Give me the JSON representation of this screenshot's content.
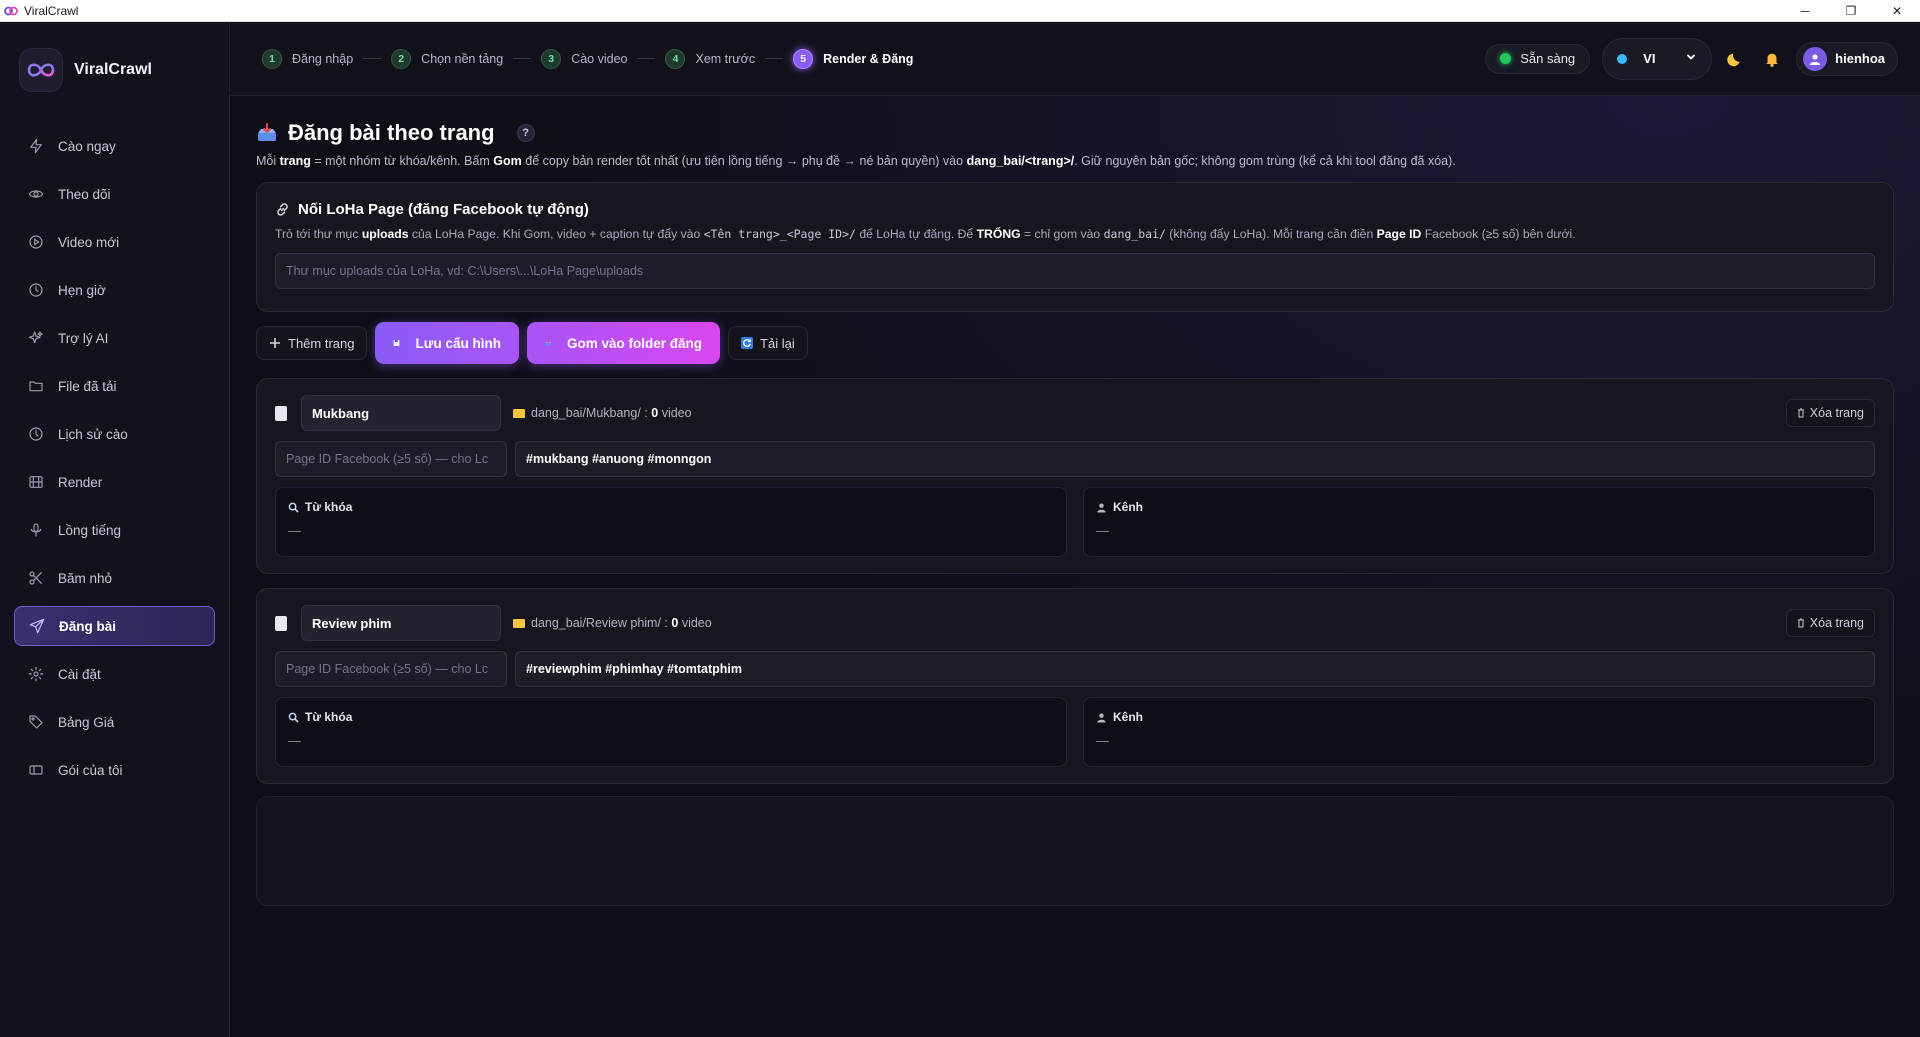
{
  "window": {
    "title": "ViralCrawl",
    "minimize": "─",
    "restore": "❐",
    "close": "✕"
  },
  "brand": {
    "name": "ViralCrawl"
  },
  "sidebar": {
    "items": [
      {
        "label": "Cào ngay",
        "icon": "bolt-icon"
      },
      {
        "label": "Theo dõi",
        "icon": "eye-icon"
      },
      {
        "label": "Video mới",
        "icon": "play-circle-icon"
      },
      {
        "label": "Hẹn giờ",
        "icon": "clock-icon"
      },
      {
        "label": "Trợ lý AI",
        "icon": "sparkle-icon"
      },
      {
        "label": "File đã tải",
        "icon": "folder-icon"
      },
      {
        "label": "Lịch sử cào",
        "icon": "history-icon"
      },
      {
        "label": "Render",
        "icon": "film-icon"
      },
      {
        "label": "Lồng tiếng",
        "icon": "mic-icon"
      },
      {
        "label": "Băm nhỏ",
        "icon": "scissors-icon"
      },
      {
        "label": "Đăng bài",
        "icon": "send-icon",
        "active": true
      },
      {
        "label": "Cài đặt",
        "icon": "gear-icon"
      },
      {
        "label": "Bảng Giá",
        "icon": "tag-icon"
      },
      {
        "label": "Gói của tôi",
        "icon": "ticket-icon"
      }
    ]
  },
  "steps": [
    {
      "num": "1",
      "label": "Đăng nhập"
    },
    {
      "num": "2",
      "label": "Chọn nền tảng"
    },
    {
      "num": "3",
      "label": "Cào video"
    },
    {
      "num": "4",
      "label": "Xem trước"
    },
    {
      "num": "5",
      "label": "Render & Đăng"
    }
  ],
  "topbar": {
    "status": "Sẵn sàng",
    "lang": "VI",
    "user": "hienhoa"
  },
  "colors": {
    "accent": "#8b5cf6",
    "accent_pink": "#d946ef",
    "status_ok": "#22c55e",
    "background": "#0f0e17"
  },
  "main": {
    "title": "Đăng bài theo trang",
    "help": "?",
    "desc": {
      "p1": "Mỗi ",
      "b1": "trang",
      "p2": " = một nhóm từ khóa/kênh. Bấm ",
      "b2": "Gom",
      "p3": " để copy bản render tốt nhất (ưu tiên lồng tiếng → phụ đề → né bản quyền) vào ",
      "b3": "dang_bai/<trang>/",
      "p4": ". Giữ nguyên bản gốc; không gom trùng (kể cả khi tool đăng đã xóa)."
    },
    "loha": {
      "title": "Nối LoHa Page (đăng Facebook tự động)",
      "d1": "Trỏ tới thư mục ",
      "d1b": "uploads",
      "d2": " của LoHa Page. Khi Gom, video + caption tự đẩy vào ",
      "d2m": "<Tên trang>_<Page ID>/",
      "d3": " để LoHa tự đăng. Để ",
      "d3b": "TRỐNG",
      "d4": " = chỉ gom vào ",
      "d4m": "dang_bai/",
      "d5": " (không đẩy LoHa). Mỗi trang cần điền ",
      "d5b": "Page ID",
      "d6": " Facebook (≥5 số) bên dưới.",
      "placeholder": "Thư mục uploads của LoHa, vd: C:\\Users\\...\\LoHa Page\\uploads"
    },
    "toolbar": {
      "add": "Thêm trang",
      "save": "Lưu cấu hình",
      "gather": "Gom vào folder đăng",
      "reload": "Tải lại"
    },
    "pages": [
      {
        "name": "Mukbang",
        "folder": "dang_bai/Mukbang/ :",
        "count": "0",
        "count_unit": "video",
        "delete": "Xóa trang",
        "pid_placeholder": "Page ID Facebook (≥5 số) — cho Lc",
        "tags": "#mukbang #anuong #monngon",
        "keywords_label": "Từ khóa",
        "keywords_value": "—",
        "channels_label": "Kênh",
        "channels_value": "—"
      },
      {
        "name": "Review phim",
        "folder": "dang_bai/Review phim/ :",
        "count": "0",
        "count_unit": "video",
        "delete": "Xóa trang",
        "pid_placeholder": "Page ID Facebook (≥5 số) — cho Lc",
        "tags": "#reviewphim #phimhay #tomtatphim",
        "keywords_label": "Từ khóa",
        "keywords_value": "—",
        "channels_label": "Kênh",
        "channels_value": "—"
      }
    ]
  }
}
